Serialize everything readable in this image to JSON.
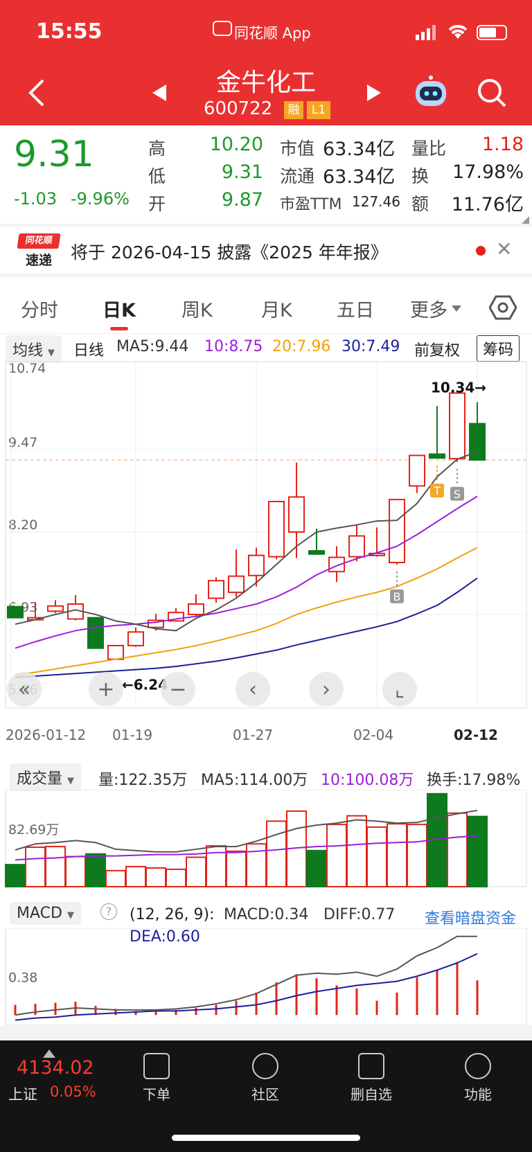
{
  "status": {
    "time": "15:55",
    "app_label": "同花顺 App"
  },
  "stock": {
    "name": "金牛化工",
    "code": "600722",
    "badge_margin": "融",
    "badge_level": "L1"
  },
  "quote": {
    "price": "9.31",
    "change": "-1.03",
    "change_pct": "-9.96%",
    "high_label": "高",
    "high": "10.20",
    "low_label": "低",
    "low": "9.31",
    "open_label": "开",
    "open": "9.87",
    "mcap_label": "市值",
    "mcap": "63.34亿",
    "float_label": "流通",
    "float": "63.34亿",
    "pe_label": "市盈TTM",
    "pe": "127.46",
    "vr_label": "量比",
    "vr": "1.18",
    "turn_label": "换",
    "turn": "17.98%",
    "amt_label": "额",
    "amt": "11.76亿"
  },
  "notice": {
    "logo_top": "同花顺",
    "logo_bottom": "速递",
    "text": "将于 2026-04-15 披露《2025 年年报》"
  },
  "tabs": [
    "分时",
    "日K",
    "周K",
    "月K",
    "五日",
    "更多"
  ],
  "ma_bar": {
    "dropdown": "均线",
    "period": "日线",
    "ma5": "MA5:9.44",
    "ma10": "10:8.75",
    "ma20": "20:7.96",
    "ma30": "30:7.49",
    "adjust": "前复权",
    "chip": "筹码"
  },
  "axis": {
    "y_labels": [
      "10.74",
      "9.47",
      "8.20",
      "6.93",
      "5.66"
    ],
    "x_labels": [
      "2026-01-12",
      "01-19",
      "01-27",
      "02-04",
      "02-12"
    ],
    "max_note": "10.34→",
    "min_note": "←6.24"
  },
  "chart_data": {
    "type": "candlestick",
    "ylim": [
      5.66,
      10.74
    ],
    "candles": [
      {
        "o": 7.05,
        "c": 6.88,
        "h": 7.05,
        "l": 6.88
      },
      {
        "o": 6.88,
        "c": 6.88,
        "h": 7.12,
        "l": 6.85
      },
      {
        "o": 6.98,
        "c": 7.06,
        "h": 7.15,
        "l": 6.95
      },
      {
        "o": 6.86,
        "c": 7.09,
        "h": 7.23,
        "l": 6.84
      },
      {
        "o": 6.88,
        "c": 6.41,
        "h": 6.88,
        "l": 6.41
      },
      {
        "o": 6.24,
        "c": 6.45,
        "h": 6.45,
        "l": 6.24
      },
      {
        "o": 6.45,
        "c": 6.66,
        "h": 6.73,
        "l": 6.43
      },
      {
        "o": 6.73,
        "c": 6.84,
        "h": 6.94,
        "l": 6.68
      },
      {
        "o": 6.83,
        "c": 6.96,
        "h": 7.03,
        "l": 6.83
      },
      {
        "o": 6.93,
        "c": 7.09,
        "h": 7.24,
        "l": 6.89
      },
      {
        "o": 7.18,
        "c": 7.45,
        "h": 7.5,
        "l": 7.11
      },
      {
        "o": 7.27,
        "c": 7.52,
        "h": 7.93,
        "l": 7.2
      },
      {
        "o": 7.53,
        "c": 7.84,
        "h": 7.96,
        "l": 7.36
      },
      {
        "o": 7.82,
        "c": 8.67,
        "h": 8.67,
        "l": 7.78
      },
      {
        "o": 8.2,
        "c": 8.74,
        "h": 9.27,
        "l": 7.8
      },
      {
        "o": 7.91,
        "c": 7.86,
        "h": 8.25,
        "l": 7.86
      },
      {
        "o": 7.59,
        "c": 7.81,
        "h": 7.98,
        "l": 7.43
      },
      {
        "o": 7.82,
        "c": 8.14,
        "h": 8.31,
        "l": 7.75
      },
      {
        "o": 7.84,
        "c": 7.87,
        "h": 8.27,
        "l": 7.82
      },
      {
        "o": 7.73,
        "c": 8.7,
        "h": 8.7,
        "l": 7.7
      },
      {
        "o": 8.91,
        "c": 9.38,
        "h": 9.38,
        "l": 8.8
      },
      {
        "o": 9.4,
        "c": 9.34,
        "h": 10.14,
        "l": 9.33
      },
      {
        "o": 9.33,
        "c": 10.34,
        "h": 10.34,
        "l": 9.28
      },
      {
        "o": 9.87,
        "c": 9.31,
        "h": 10.2,
        "l": 9.31
      }
    ],
    "ma5": [
      6.78,
      6.85,
      6.93,
      7.0,
      6.93,
      6.83,
      6.78,
      6.71,
      6.68,
      6.87,
      7.0,
      7.18,
      7.42,
      7.7,
      7.98,
      8.2,
      8.26,
      8.31,
      8.37,
      8.38,
      8.64,
      9.05,
      9.32,
      9.44
    ],
    "ma10": [
      6.41,
      6.51,
      6.6,
      6.68,
      6.73,
      6.76,
      6.78,
      6.81,
      6.86,
      6.9,
      6.95,
      7.02,
      7.09,
      7.2,
      7.35,
      7.54,
      7.68,
      7.79,
      7.88,
      7.98,
      8.16,
      8.36,
      8.56,
      8.75
    ],
    "ma20": [
      6.0,
      6.04,
      6.09,
      6.14,
      6.19,
      6.24,
      6.29,
      6.34,
      6.39,
      6.45,
      6.52,
      6.6,
      6.68,
      6.79,
      6.93,
      7.03,
      7.12,
      7.2,
      7.27,
      7.36,
      7.49,
      7.63,
      7.8,
      7.96
    ],
    "ma30": [
      5.96,
      5.98,
      6.0,
      6.02,
      6.04,
      6.06,
      6.08,
      6.1,
      6.13,
      6.17,
      6.21,
      6.26,
      6.32,
      6.38,
      6.46,
      6.53,
      6.6,
      6.67,
      6.74,
      6.82,
      6.94,
      7.07,
      7.27,
      7.49
    ],
    "volume": [
      3.3,
      5.9,
      6.0,
      4.5,
      4.9,
      2.4,
      3.0,
      2.8,
      2.6,
      4.4,
      6.1,
      5.3,
      6.4,
      9.8,
      11.3,
      5.4,
      9.3,
      10.6,
      8.9,
      9.4,
      9.3,
      13.9,
      11.0,
      10.5
    ],
    "vol_ma5": [
      5.5,
      6.4,
      6.6,
      6.9,
      6.6,
      5.6,
      5.4,
      5.2,
      5.2,
      5.6,
      6.0,
      6.0,
      6.8,
      7.8,
      8.7,
      9.2,
      9.5,
      10.0,
      9.8,
      9.5,
      9.6,
      10.3,
      10.9,
      11.4
    ],
    "vol_ma10": [
      4.0,
      4.2,
      4.3,
      4.5,
      4.6,
      4.6,
      4.7,
      4.8,
      4.8,
      4.9,
      5.1,
      5.1,
      5.3,
      5.5,
      5.8,
      6.0,
      6.1,
      6.3,
      6.5,
      6.6,
      6.7,
      7.1,
      7.4,
      7.6
    ],
    "macd_diff": [
      0.0,
      0.03,
      0.05,
      0.07,
      0.06,
      0.05,
      0.05,
      0.05,
      0.06,
      0.08,
      0.11,
      0.15,
      0.21,
      0.3,
      0.39,
      0.41,
      0.4,
      0.42,
      0.38,
      0.45,
      0.58,
      0.66,
      0.77,
      0.77
    ],
    "macd_dea": [
      -0.05,
      -0.03,
      -0.02,
      0.0,
      0.01,
      0.02,
      0.03,
      0.04,
      0.04,
      0.05,
      0.06,
      0.08,
      0.1,
      0.14,
      0.19,
      0.23,
      0.26,
      0.29,
      0.31,
      0.33,
      0.38,
      0.44,
      0.51,
      0.6
    ],
    "macd_hist": [
      0.1,
      0.11,
      0.12,
      0.13,
      0.09,
      0.06,
      0.04,
      0.04,
      0.05,
      0.07,
      0.1,
      0.14,
      0.22,
      0.32,
      0.4,
      0.36,
      0.29,
      0.26,
      0.14,
      0.22,
      0.37,
      0.44,
      0.52,
      0.34
    ]
  },
  "markers": {
    "t": "T",
    "s": "S",
    "b": "B"
  },
  "volume": {
    "dropdown": "成交量",
    "vol": "量:122.35万",
    "ma5": "MA5:114.00万",
    "ma10": "10:100.08万",
    "turnover": "换手:17.98%",
    "axis_label": "82.69万"
  },
  "macd": {
    "dropdown": "MACD",
    "params": "(12, 26, 9):",
    "macd": "MACD:0.34",
    "diff": "DIFF:0.77",
    "dea": "DEA:0.60",
    "link": "查看暗盘资金",
    "axis_label": "0.38"
  },
  "bottom": {
    "index_value": "4134.02",
    "index_name": "上证",
    "index_pct": "0.05%",
    "items": [
      "下单",
      "社区",
      "删自选",
      "功能"
    ]
  },
  "colors": {
    "up": "#e2231a",
    "down": "#0d7a1e",
    "ma5": "#555555",
    "ma10": "#9b1fd8",
    "ma20": "#f0a10a",
    "ma30": "#1a1f9a",
    "header": "#e93030"
  }
}
